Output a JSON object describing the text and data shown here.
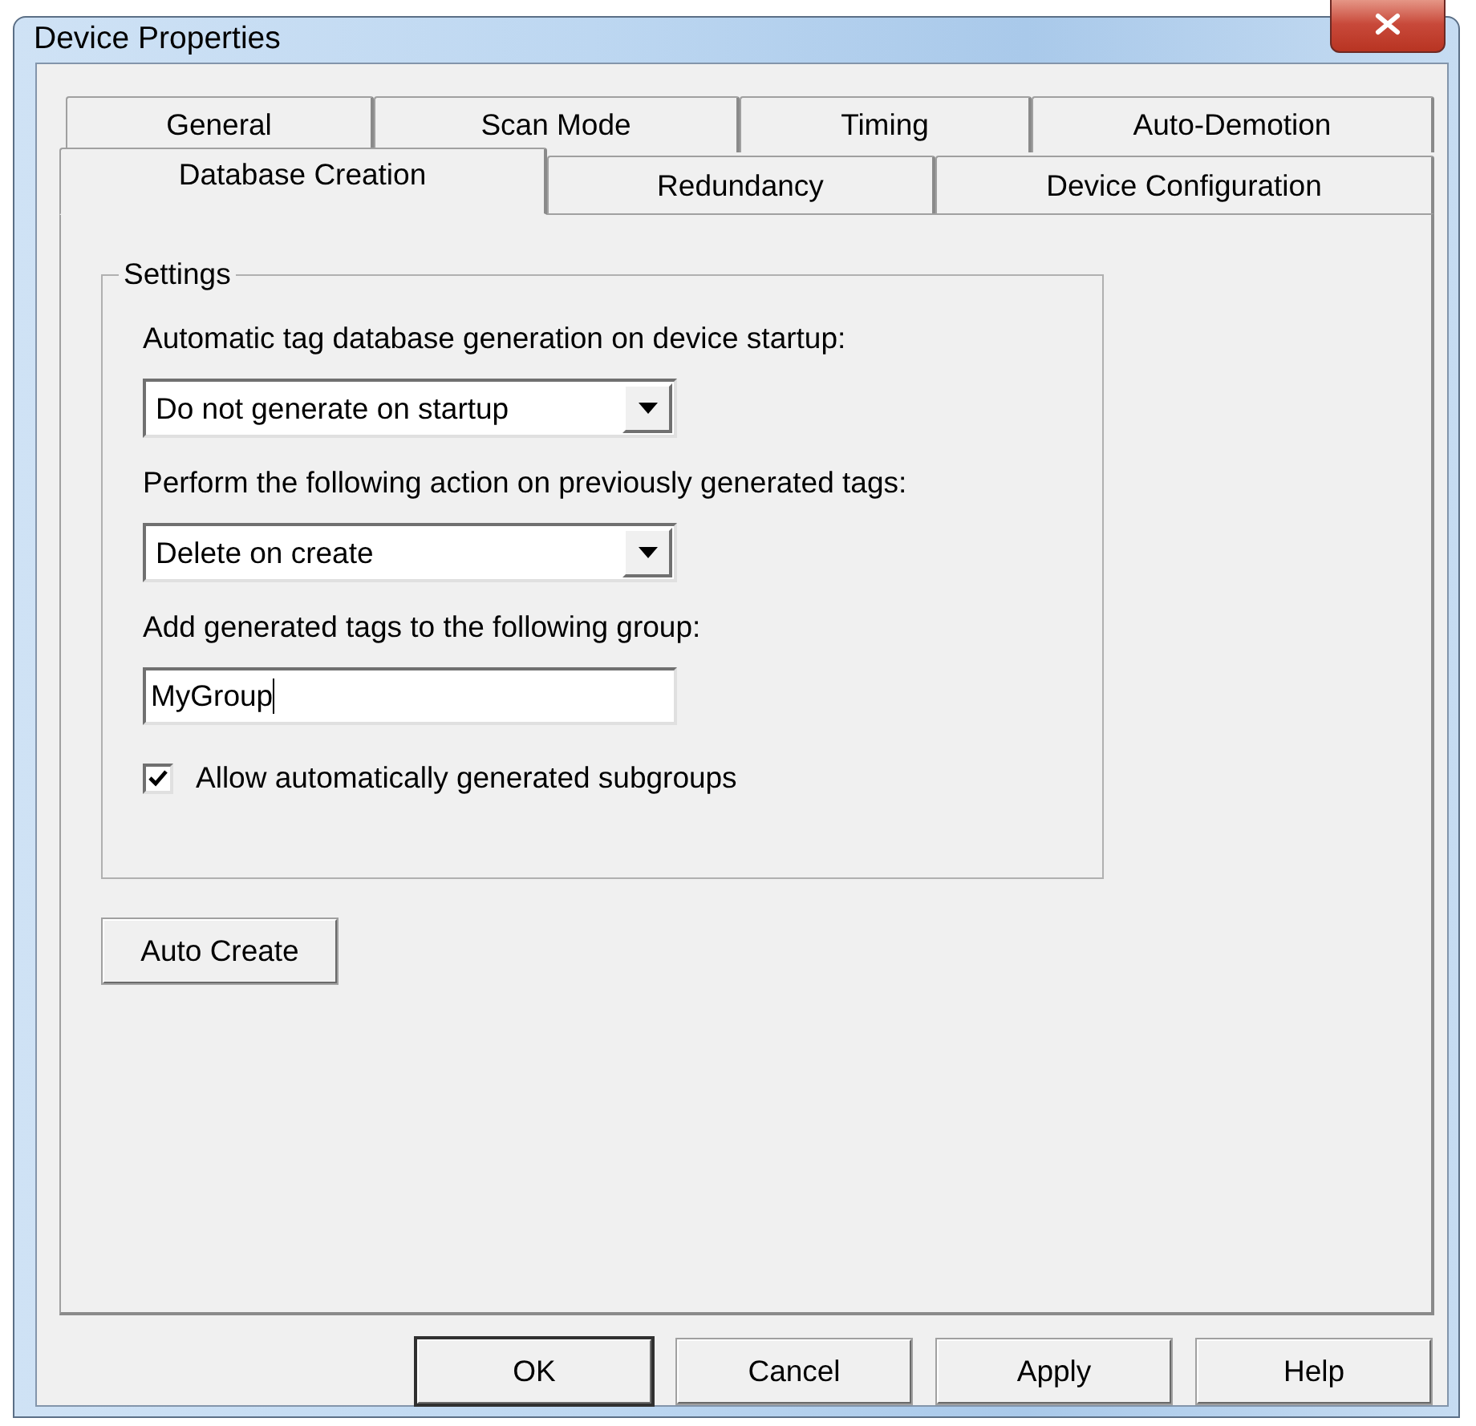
{
  "window": {
    "title": "Device Properties"
  },
  "tab_rows": [
    {
      "tabs": [
        {
          "label": "General",
          "selected": false
        },
        {
          "label": "Scan Mode",
          "selected": false
        },
        {
          "label": "Timing",
          "selected": false
        },
        {
          "label": "Auto-Demotion",
          "selected": false
        }
      ]
    },
    {
      "tabs": [
        {
          "label": "Database Creation",
          "selected": true
        },
        {
          "label": "Redundancy",
          "selected": false
        },
        {
          "label": "Device Configuration",
          "selected": false
        }
      ]
    }
  ],
  "settings": {
    "title": "Settings",
    "items": [
      {
        "kind": "dropdown",
        "label": "Automatic tag database generation on device startup:",
        "value": "Do not generate on startup"
      },
      {
        "kind": "dropdown",
        "label": "Perform the following action on previously generated tags:",
        "value": "Delete on create"
      },
      {
        "kind": "text",
        "label": "Add generated tags to the following group:",
        "value": "MyGroup"
      },
      {
        "kind": "checkbox",
        "label": "Allow automatically generated subgroups",
        "checked": true
      }
    ]
  },
  "auto_create_button": "Auto Create",
  "buttons": [
    {
      "label": "OK",
      "default": true
    },
    {
      "label": "Cancel",
      "default": false
    },
    {
      "label": "Apply",
      "default": false
    },
    {
      "label": "Help",
      "default": false
    }
  ]
}
